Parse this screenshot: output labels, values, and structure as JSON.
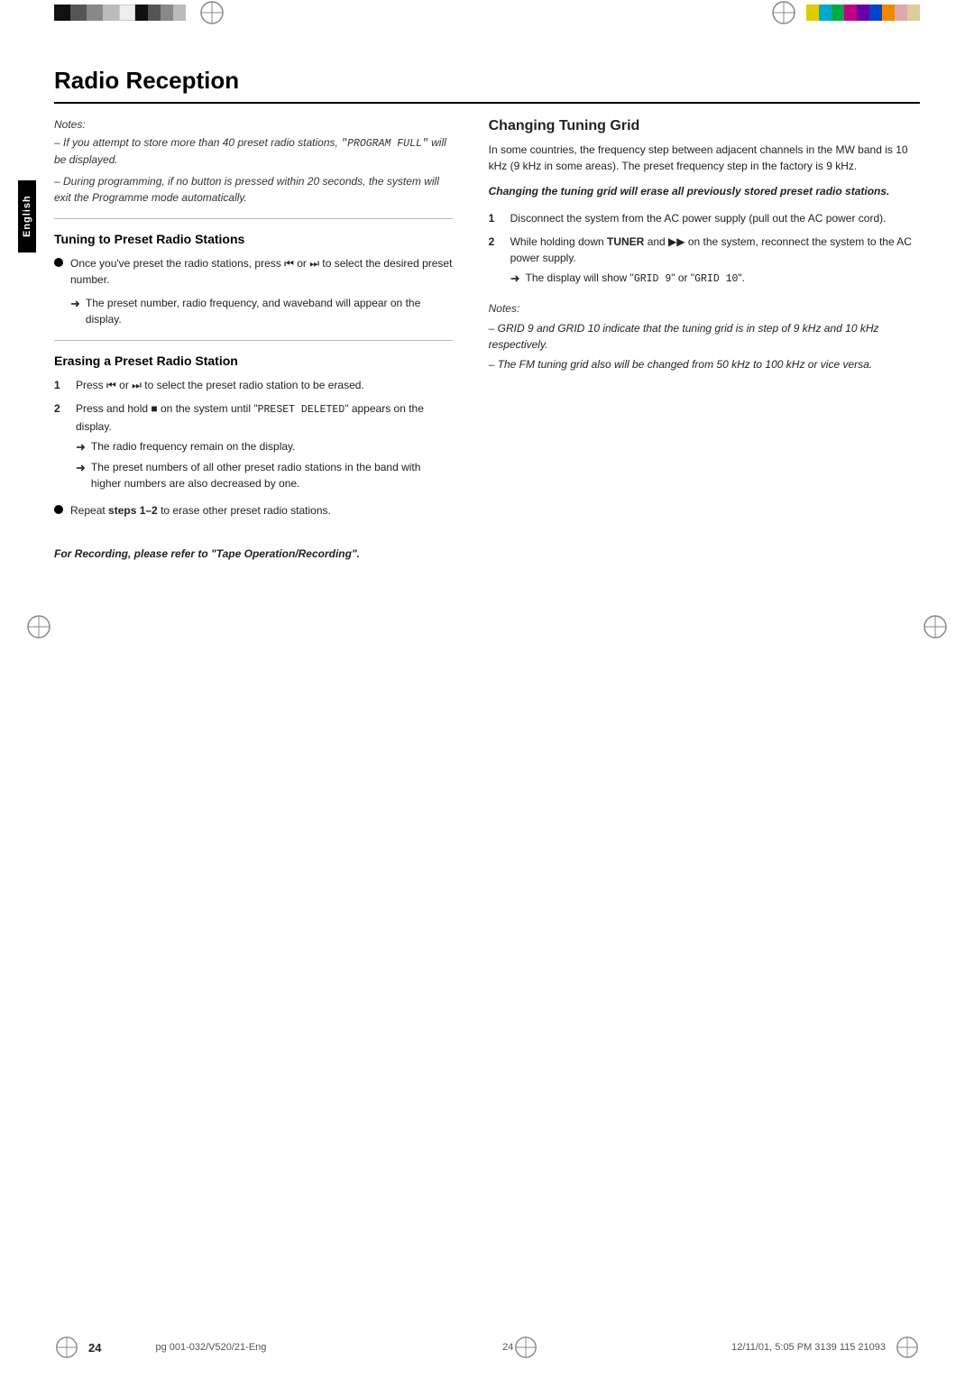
{
  "page": {
    "title": "Radio Reception",
    "number": "24",
    "bottom_left_ref": "pg 001-032/V520/21-Eng",
    "bottom_center_num": "24",
    "bottom_right": "12/11/01, 5:05 PM 3139 115 21093",
    "sidebar_label": "English"
  },
  "notes_section": {
    "label": "Notes:",
    "note1_text": "– If you attempt to store more than 40 preset radio stations, ",
    "note1_mono": "\"PROGRAM FULL\"",
    "note1_end": " will be displayed.",
    "note2": "– During programming, if no button is pressed within 20 seconds, the system will exit the Programme mode automatically."
  },
  "tuning_section": {
    "heading": "Tuning to Preset Radio Stations",
    "bullet1_text": "Once you've preset the radio stations, press ⏮ or ⏭ to select the desired preset number.",
    "arrow1": "The preset number, radio frequency, and waveband will appear on the display."
  },
  "erasing_section": {
    "heading": "Erasing a Preset Radio Station",
    "step1": "Press ⏮ or ⏭ to select the preset radio station to be erased.",
    "step2_text": "Press and hold ■ on the system until \"",
    "step2_mono": "PRESET DELETED",
    "step2_end": "\" appears on the display.",
    "step2_arrow1": "The radio frequency remain on the display.",
    "step2_arrow2": "The preset numbers of all other preset radio stations in the band with higher numbers are also decreased by one.",
    "step3_bullet": "Repeat ",
    "step3_bold": "steps 1–2",
    "step3_end": " to erase other preset radio stations.",
    "recording_note": "For Recording, please refer to \"Tape Operation/Recording\"."
  },
  "changing_tuning": {
    "heading": "Changing Tuning Grid",
    "intro": "In some countries, the frequency step between adjacent channels in the MW band is 10 kHz (9 kHz in some areas). The preset frequency step in the factory is 9 kHz.",
    "warning": "Changing the tuning grid will erase all previously stored preset radio stations.",
    "step1": "Disconnect the system from the AC power supply (pull out the AC power cord).",
    "step2_text": "While holding down ",
    "step2_bold1": "TUNER",
    "step2_and": " and ▶▶ on the system, reconnect the system to the AC power supply.",
    "step2_arrow_text": "The display will show \"",
    "step2_arrow_mono1": "GRID 9",
    "step2_arrow_or": "\" or \"",
    "step2_arrow_mono2": "GRID 10",
    "step2_arrow_end": "\".",
    "notes_label": "Notes:",
    "note1": "– GRID 9 and GRID 10 indicate that the tuning grid is in step of 9 kHz and 10 kHz respectively.",
    "note2": "– The FM tuning grid also will be changed from 50 kHz to 100 kHz or vice versa."
  }
}
